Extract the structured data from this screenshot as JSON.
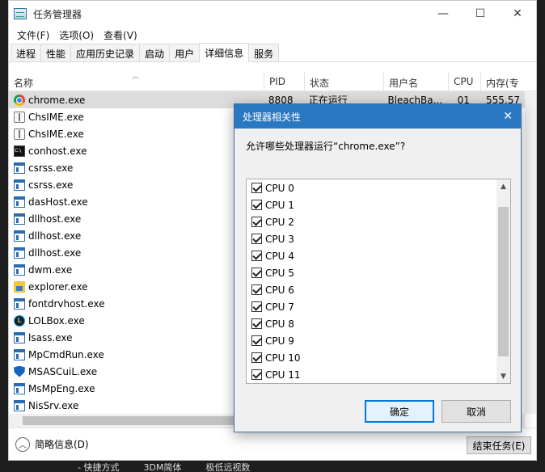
{
  "window": {
    "title": "任务管理器",
    "minimize": "—",
    "maximize": "☐",
    "close": "✕"
  },
  "menu": [
    "文件(F)",
    "选项(O)",
    "查看(V)"
  ],
  "tabs": [
    "进程",
    "性能",
    "应用历史记录",
    "启动",
    "用户",
    "详细信息",
    "服务"
  ],
  "active_tab": "详细信息",
  "columns": [
    "名称",
    "PID",
    "状态",
    "用户名",
    "CPU",
    "内存(专"
  ],
  "processes": [
    {
      "name": "chrome.exe",
      "icon": "chrome-icon",
      "pid": "8808",
      "status": "正在运行",
      "user": "BleachBa...",
      "cpu": "01",
      "mem": "555,57"
    },
    {
      "name": "ChsIME.exe",
      "icon": "ime-icon"
    },
    {
      "name": "ChsIME.exe",
      "icon": "ime-icon"
    },
    {
      "name": "conhost.exe",
      "icon": "console-icon"
    },
    {
      "name": "csrss.exe",
      "icon": "window-icon"
    },
    {
      "name": "csrss.exe",
      "icon": "window-icon"
    },
    {
      "name": "dasHost.exe",
      "icon": "window-icon"
    },
    {
      "name": "dllhost.exe",
      "icon": "window-icon"
    },
    {
      "name": "dllhost.exe",
      "icon": "window-icon"
    },
    {
      "name": "dllhost.exe",
      "icon": "window-icon"
    },
    {
      "name": "dwm.exe",
      "icon": "window-icon"
    },
    {
      "name": "explorer.exe",
      "icon": "folder-icon"
    },
    {
      "name": "fontdrvhost.exe",
      "icon": "window-icon"
    },
    {
      "name": "LOLBox.exe",
      "icon": "lol-icon"
    },
    {
      "name": "lsass.exe",
      "icon": "window-icon"
    },
    {
      "name": "MpCmdRun.exe",
      "icon": "window-icon"
    },
    {
      "name": "MSASCuiL.exe",
      "icon": "shield-icon"
    },
    {
      "name": "MsMpEng.exe",
      "icon": "window-icon"
    },
    {
      "name": "NisSrv.exe",
      "icon": "window-icon"
    }
  ],
  "footer": {
    "fewer_details": "简略信息(D)",
    "end_task": "结束任务(E)"
  },
  "dialog": {
    "title": "处理器相关性",
    "prompt": "允许哪些处理器运行“chrome.exe”?",
    "cpus": [
      "CPU 0",
      "CPU 1",
      "CPU 2",
      "CPU 3",
      "CPU 4",
      "CPU 5",
      "CPU 6",
      "CPU 7",
      "CPU 8",
      "CPU 9",
      "CPU 10",
      "CPU 11"
    ],
    "ok": "确定",
    "cancel": "取消"
  },
  "background_text": [
    "- 快捷方式",
    "3DM简体",
    "极低远视数"
  ],
  "accent_color": "#2b78c2"
}
